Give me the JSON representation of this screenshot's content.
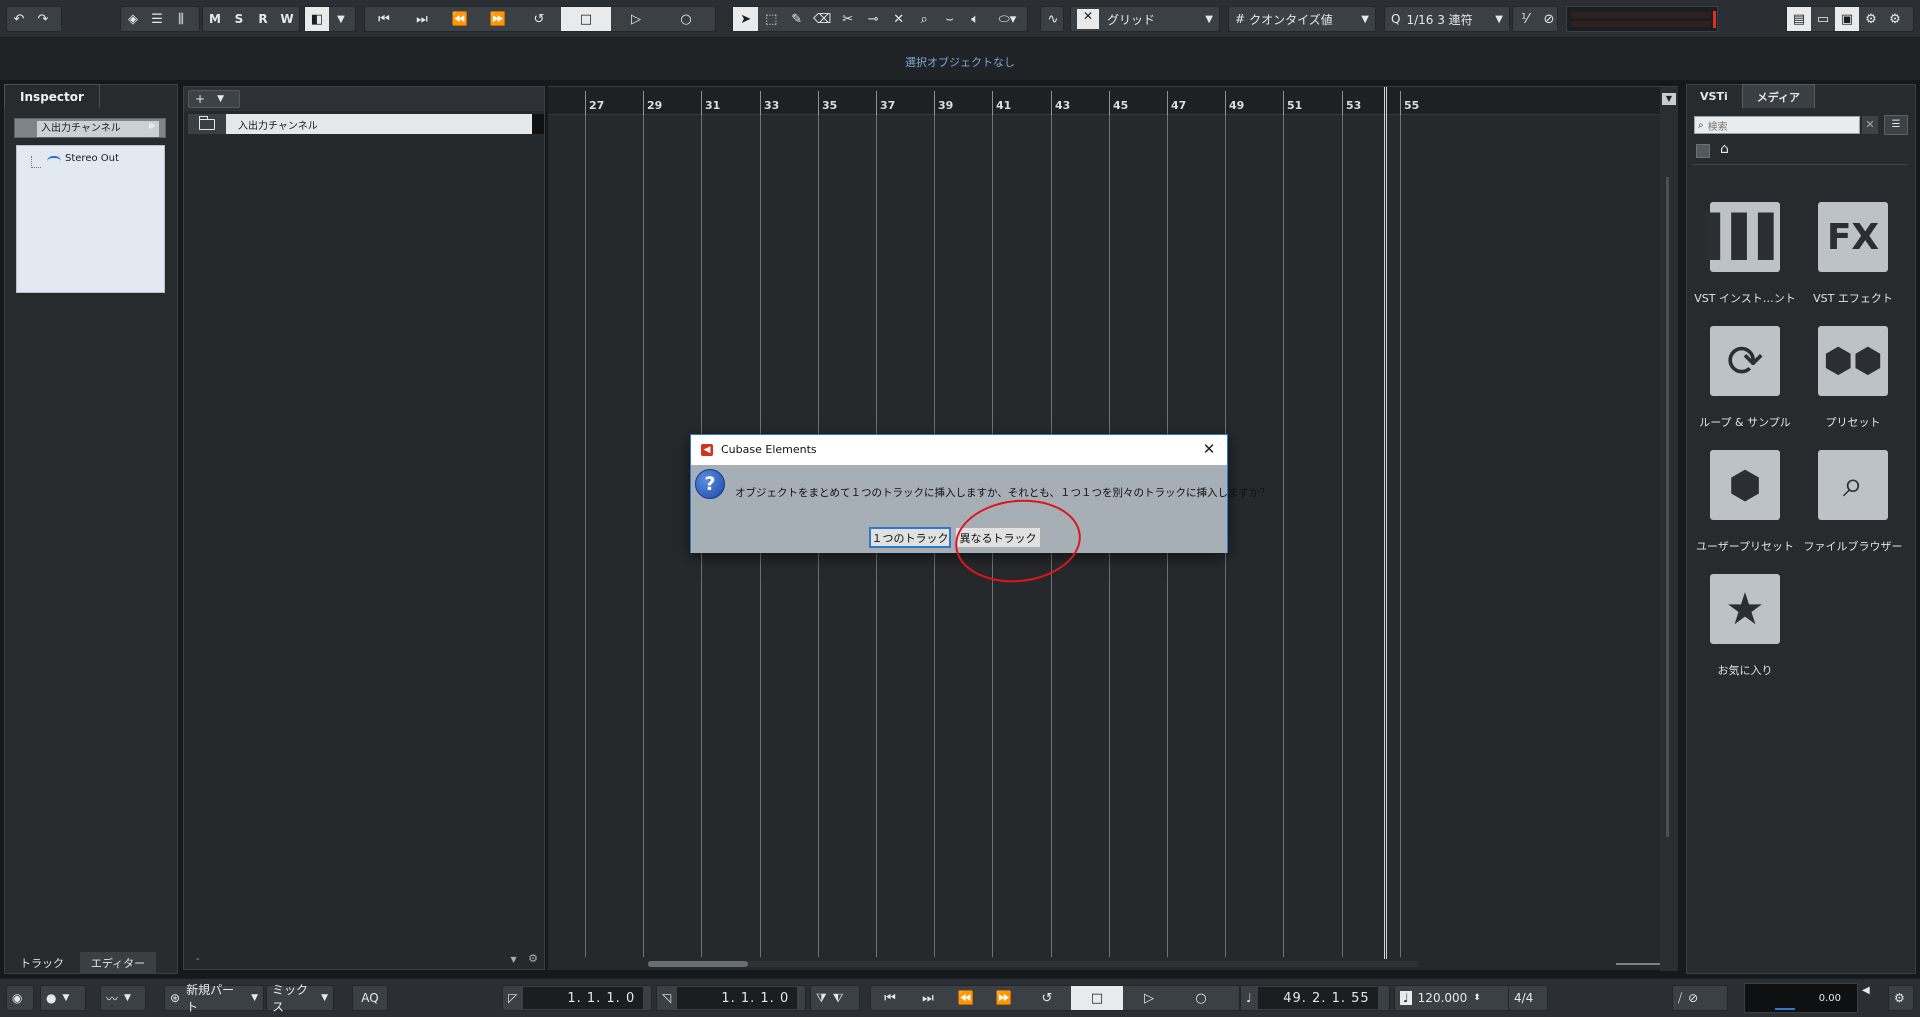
{
  "toolbar": {
    "msrw": [
      "M",
      "S",
      "R",
      "W"
    ],
    "snap_type": "グリッド",
    "quantize_type": "クオンタイズ値",
    "quantize_value": "1/16 3 連符"
  },
  "info_line": {
    "text": "選択オブジェクトなし"
  },
  "inspector": {
    "tab": "Inspector",
    "section": "入出力チャンネル",
    "routing_output": "Stereo Out",
    "bottom_tabs": [
      "トラック",
      "エディター"
    ]
  },
  "track_list": {
    "add_label": "+",
    "folder_track_name": "入出力チャンネル",
    "footer_left": "-",
    "footer_right": "⚙"
  },
  "ruler": {
    "bars": [
      "27",
      "29",
      "31",
      "33",
      "35",
      "37",
      "39",
      "41",
      "43",
      "45",
      "47",
      "49",
      "51",
      "53",
      "55"
    ]
  },
  "rack": {
    "tabs": [
      "VSTi",
      "メディア"
    ],
    "active_tab": "メディア",
    "search_placeholder": "検索",
    "tiles": [
      {
        "label": "VST インスト…ント",
        "icon": "piano-keys-icon"
      },
      {
        "label": "VST エフェクト",
        "icon": "fx-icon"
      },
      {
        "label": "ループ & サンプル",
        "icon": "loop-icon"
      },
      {
        "label": "プリセット",
        "icon": "hexagons-icon"
      },
      {
        "label": "ユーザープリセット",
        "icon": "user-preset-icon"
      },
      {
        "label": "ファイルブラウザー",
        "icon": "file-browser-icon"
      },
      {
        "label": "お気に入り",
        "icon": "star-icon"
      }
    ]
  },
  "transport": {
    "part_mode": "新規パート",
    "mix_mode": "ミックス",
    "aq": "AQ",
    "left_locator": "1. 1. 1.  0",
    "right_locator": "1. 1. 1.  0",
    "position": "49. 2. 1. 55",
    "tempo": "120.000",
    "signature": "4/4",
    "level": "0.00"
  },
  "dialog": {
    "title": "Cubase Elements",
    "message": "オブジェクトをまとめて１つのトラックに挿入しますか、それとも、１つ１つを別々のトラックに挿入しますか？",
    "button_one_track": "１つのトラック",
    "button_different_tracks": "異なるトラック",
    "annotation_color": "#e0151b"
  }
}
